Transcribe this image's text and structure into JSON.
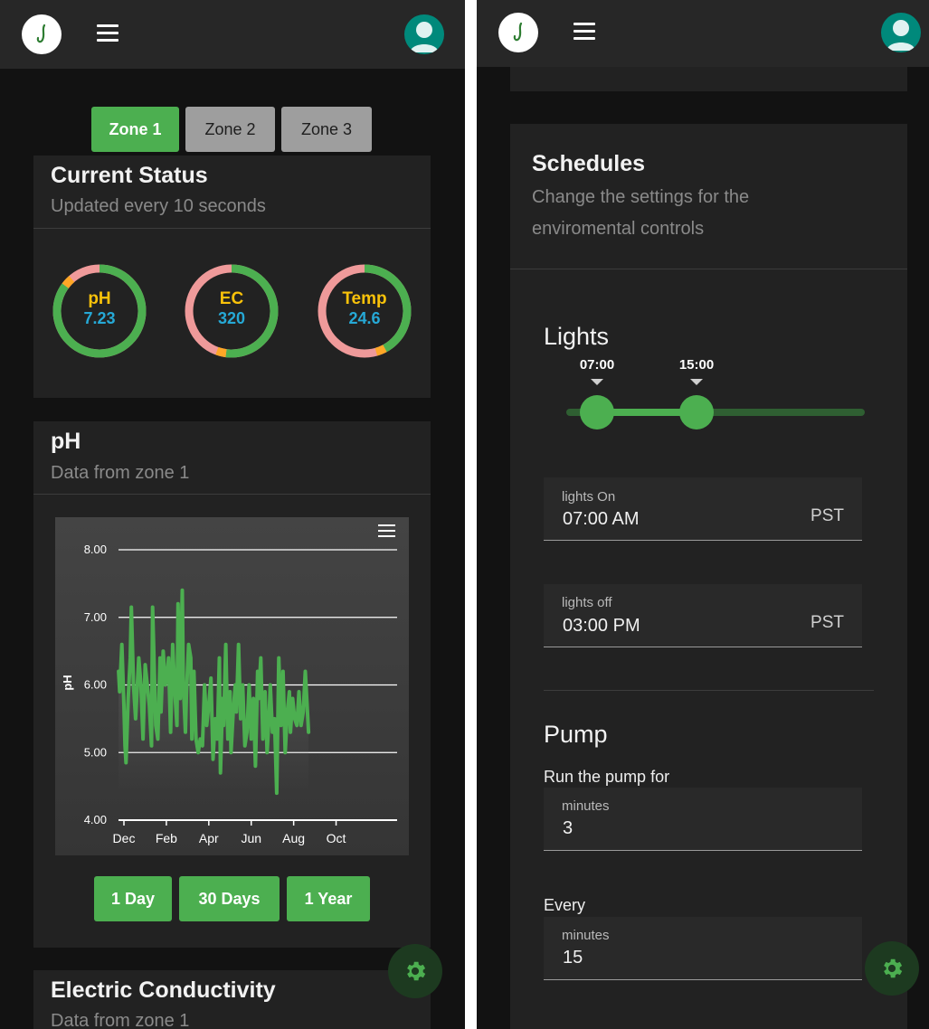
{
  "colors": {
    "accent": "#4caf50",
    "background": "#121212",
    "card": "#222222",
    "gauge_track": "#ef9a9a",
    "gauge_fill": "#4caf50",
    "gauge_marker": "#ffa726",
    "gauge_label": "#f9c20a",
    "gauge_value": "#26a9d6"
  },
  "left": {
    "logo_icon": "leaf-logo",
    "menu_icon": "hamburger-menu",
    "avatar_icon": "user-avatar",
    "zones": [
      "Zone 1",
      "Zone 2",
      "Zone 3"
    ],
    "active_zone": "Zone 1",
    "status": {
      "title": "Current Status",
      "subtitle": "Updated every 10 seconds",
      "gauges": [
        {
          "name": "pH",
          "value": "7.23",
          "fill_fraction": 0.85
        },
        {
          "name": "EC",
          "value": "320",
          "fill_fraction": 0.52
        },
        {
          "name": "Temp",
          "value": "24.6",
          "fill_fraction": 0.42
        }
      ]
    },
    "ph_card": {
      "title": "pH",
      "subtitle": "Data from zone 1",
      "ranges": [
        "1 Day",
        "30 Days",
        "1 Year"
      ]
    },
    "ec_card": {
      "title": "Electric Conductivity",
      "subtitle": "Data from zone 1"
    },
    "settings_icon": "gear"
  },
  "right": {
    "schedules": {
      "title": "Schedules",
      "subtitle_line1": "Change the settings for the",
      "subtitle_line2": "enviromental controls"
    },
    "lights": {
      "title": "Lights",
      "slider_start_label": "07:00",
      "slider_end_label": "15:00",
      "slider_start_hours": 7,
      "slider_end_hours": 15,
      "slider_max_hours": 24,
      "on_field": {
        "label": "lights On",
        "value": "07:00  AM",
        "suffix": "PST"
      },
      "off_field": {
        "label": "lights off",
        "value": "03:00  PM",
        "suffix": "PST"
      }
    },
    "pump": {
      "title": "Pump",
      "run_label": "Run the pump for",
      "run_field": {
        "label": "minutes",
        "value": "3"
      },
      "every_label": "Every",
      "every_field": {
        "label": "minutes",
        "value": "15"
      }
    }
  },
  "chart_data": {
    "type": "line",
    "title": "",
    "xlabel": "",
    "ylabel": "pH",
    "ylim": [
      4.0,
      8.0
    ],
    "yticks": [
      "8.00",
      "7.00",
      "6.00",
      "5.00",
      "4.00"
    ],
    "xticks": [
      "Dec",
      "Feb",
      "Apr",
      "Jun",
      "Aug",
      "Oct"
    ],
    "xlim_months": [
      0,
      11
    ],
    "grid": true,
    "menu_icon": "chart-menu",
    "series": [
      {
        "color": "#4caf50",
        "x_months": [
          -0.25,
          -0.2,
          -0.1,
          0.0,
          0.05,
          0.1,
          0.2,
          0.3,
          0.35,
          0.45,
          0.55,
          0.7,
          0.8,
          0.9,
          1.0,
          1.1,
          1.2,
          1.3,
          1.35,
          1.45,
          1.5,
          1.6,
          1.7,
          1.75,
          1.85,
          1.95,
          2.05,
          2.1,
          2.2,
          2.3,
          2.4,
          2.5,
          2.55,
          2.65,
          2.75,
          2.8,
          2.9,
          2.95,
          3.05,
          3.15,
          3.2,
          3.3,
          3.4,
          3.5,
          3.6,
          3.7,
          3.8,
          3.9,
          4.0,
          4.1,
          4.2,
          4.3,
          4.4,
          4.5,
          4.55,
          4.65,
          4.7,
          4.8,
          4.9,
          5.0,
          5.05,
          5.15,
          5.25,
          5.3,
          5.4,
          5.5,
          5.6,
          5.7,
          5.8,
          5.9,
          6.0,
          6.1,
          6.2,
          6.3,
          6.35,
          6.45,
          6.55,
          6.65,
          6.75,
          6.85,
          6.9,
          7.0,
          7.1,
          7.2,
          7.3,
          7.4,
          7.5,
          7.6,
          7.7,
          7.8,
          7.85,
          7.95,
          8.05,
          8.15,
          8.25,
          8.35,
          8.45,
          8.55,
          8.65,
          8.7
        ],
        "values": [
          6.2,
          5.9,
          6.6,
          5.7,
          5.1,
          4.85,
          5.8,
          6.4,
          7.15,
          6.0,
          5.5,
          6.4,
          6.0,
          5.2,
          6.3,
          6.0,
          5.7,
          5.1,
          7.15,
          6.0,
          5.4,
          5.2,
          6.4,
          5.6,
          6.5,
          6.0,
          6.2,
          6.4,
          5.3,
          6.6,
          5.9,
          5.4,
          7.2,
          5.8,
          7.4,
          6.0,
          5.3,
          5.9,
          6.6,
          6.4,
          5.2,
          6.2,
          5.2,
          5.0,
          5.2,
          5.1,
          6.0,
          5.4,
          5.7,
          6.1,
          4.9,
          5.5,
          5.2,
          6.4,
          4.7,
          5.8,
          5.4,
          6.6,
          5.2,
          5.9,
          5.0,
          5.6,
          6.0,
          5.6,
          6.6,
          5.5,
          6.0,
          5.1,
          5.3,
          6.0,
          5.2,
          5.8,
          4.8,
          6.2,
          5.8,
          6.4,
          5.2,
          5.9,
          5.0,
          5.6,
          6.0,
          5.3,
          5.5,
          4.4,
          6.4,
          5.4,
          6.2,
          5.0,
          5.6,
          5.9,
          5.3,
          5.8,
          5.5,
          5.4,
          5.9,
          5.4,
          5.6,
          6.2,
          5.6,
          5.3
        ]
      }
    ]
  }
}
